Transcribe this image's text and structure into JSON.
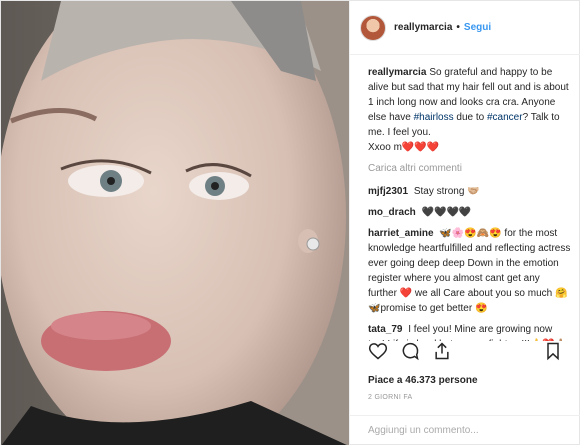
{
  "post": {
    "username": "reallymarcia",
    "separator": "•",
    "follow_label": "Segui",
    "caption_user": "reallymarcia",
    "caption_text_1": "So grateful and happy to be alive but sad that my hair fell out and is about 1 inch long now and looks cra cra. Anyone else have ",
    "caption_tag_1": "#hairloss",
    "caption_text_2": " due to ",
    "caption_tag_2": "#cancer",
    "caption_text_3": "? Talk to me. I feel you.",
    "caption_signoff": "Xxoo m❤️❤️❤️"
  },
  "comments": {
    "load_more": "Carica altri commenti",
    "items": [
      {
        "user": "mjfj2301",
        "text": "Stay strong 🤝🏼"
      },
      {
        "user": "mo_drach",
        "text": "🖤🖤🖤🖤"
      },
      {
        "user": "harriet_amine",
        "text": "🦋🌸😍🙈😍 for the most knowledge heartfulfilled and reflecting actress ever going deep deep Down in the emotion register where you almost cant get any further ❤️ we all Care about you so much 🤗🦋promise to get better 😍"
      },
      {
        "user": "tata_79",
        "text": "I feel you! Mine are growing now too! Life is hard but we are fighters!!!👍❤️🙏🏼"
      }
    ]
  },
  "footer": {
    "likes": "Piace a 46.373 persone",
    "time": "2 giorni fa",
    "add_comment_placeholder": "Aggiungi un commento..."
  },
  "icons": {
    "like": "heart-icon",
    "comment": "comment-icon",
    "share": "share-icon",
    "save": "bookmark-icon"
  },
  "colors": {
    "link": "#3897f0",
    "hashtag": "#003569",
    "muted": "#999999",
    "text": "#262626"
  }
}
